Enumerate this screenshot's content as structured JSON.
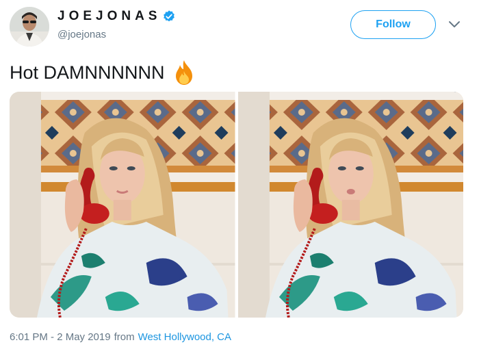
{
  "user": {
    "display_name": "JOEJONAS",
    "handle": "@joejonas",
    "verified": true
  },
  "actions": {
    "follow_label": "Follow"
  },
  "tweet": {
    "text": "Hot DAMNNNNNN",
    "emoji": "fire-icon",
    "photos": [
      {
        "icon": "photo-woman-red-phone"
      },
      {
        "icon": "photo-woman-red-phone"
      }
    ]
  },
  "meta": {
    "timestamp": "6:01 PM - 2 May 2019",
    "from_label": "from",
    "location": "West Hollywood, CA"
  },
  "colors": {
    "accent": "#1da1f2",
    "link": "#1b95e0",
    "muted": "#657786",
    "verified": "#1da1f2"
  }
}
